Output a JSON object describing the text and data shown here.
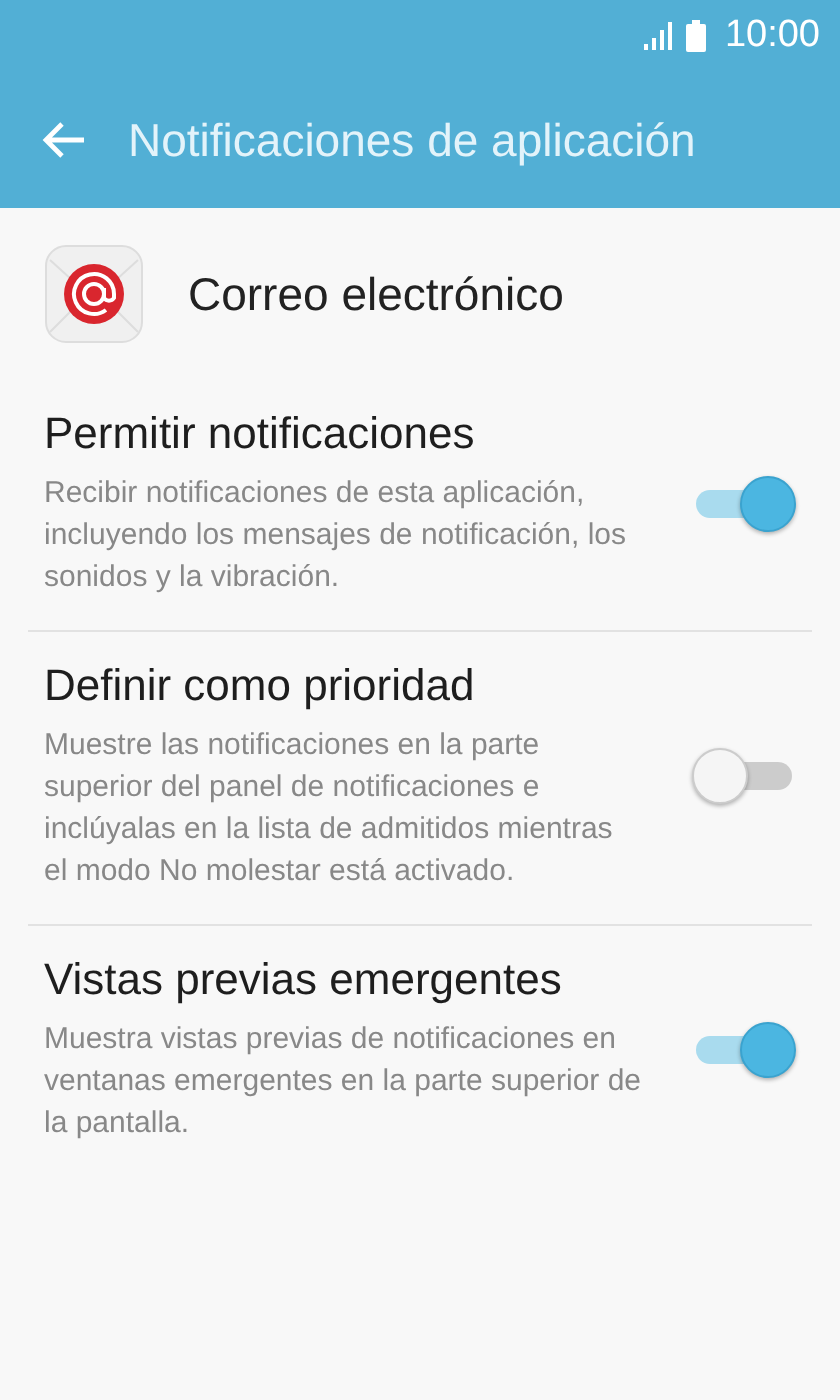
{
  "status_bar": {
    "time": "10:00"
  },
  "header": {
    "title": "Notificaciones de aplicación"
  },
  "app": {
    "name": "Correo electrónico"
  },
  "settings": [
    {
      "title": "Permitir notificaciones",
      "description": "Recibir notificaciones de esta aplicación, incluyendo los mensajes de notificación, los sonidos y la vibración.",
      "on": true
    },
    {
      "title": "Definir como prioridad",
      "description": "Muestre las notificaciones en la parte superior del panel de notificaciones e inclúyalas en la lista de admitidos mientras el modo No molestar está activado.",
      "on": false
    },
    {
      "title": "Vistas previas emergentes",
      "description": "Muestra vistas previas de notificaciones en ventanas emergentes en la parte superior de la pantalla.",
      "on": true
    }
  ]
}
